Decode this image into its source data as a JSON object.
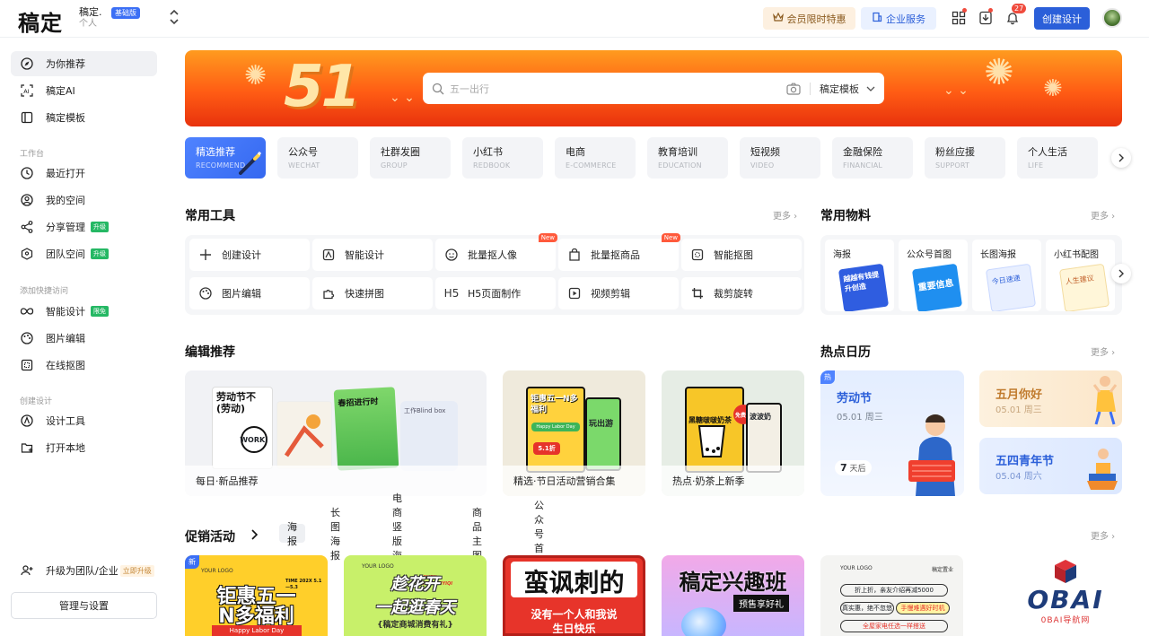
{
  "brand": {
    "logo": "稿定",
    "workspace_name": "稿定.",
    "workspace_type": "个人",
    "plan_badge": "基础版"
  },
  "topbar": {
    "vip_label": "会员限时特惠",
    "enterprise_label": "企业服务",
    "notification_count": "27",
    "create_label": "创建设计"
  },
  "sidebar": {
    "main": [
      {
        "label": "为你推荐"
      },
      {
        "label": "稿定AI"
      },
      {
        "label": "稿定模板"
      }
    ],
    "workbench_label": "工作台",
    "workbench": [
      {
        "label": "最近打开"
      },
      {
        "label": "我的空间"
      },
      {
        "label": "分享管理",
        "tag": "升级"
      },
      {
        "label": "团队空间",
        "tag": "升级"
      }
    ],
    "quick_label": "添加快捷访问",
    "quick": [
      {
        "label": "智能设计",
        "tag": "限免"
      },
      {
        "label": "图片编辑"
      },
      {
        "label": "在线抠图"
      }
    ],
    "create_label": "创建设计",
    "create": [
      {
        "label": "设计工具"
      },
      {
        "label": "打开本地"
      }
    ],
    "upgrade_label": "升级为团队/企业",
    "upgrade_tag": "立即升级",
    "manage_label": "管理与设置"
  },
  "banner": {
    "number": "51",
    "search_placeholder": "五一出行",
    "search_scope": "稿定模板"
  },
  "categories": [
    {
      "cn": "精选推荐",
      "en": "RECOMMEND"
    },
    {
      "cn": "公众号",
      "en": "WECHAT"
    },
    {
      "cn": "社群发圈",
      "en": "GROUP"
    },
    {
      "cn": "小红书",
      "en": "REDBOOK"
    },
    {
      "cn": "电商",
      "en": "E-COMMERCE"
    },
    {
      "cn": "教育培训",
      "en": "EDUCATION"
    },
    {
      "cn": "短视频",
      "en": "VIDEO"
    },
    {
      "cn": "金融保险",
      "en": "FINANCIAL"
    },
    {
      "cn": "粉丝应援",
      "en": "SUPPORT"
    },
    {
      "cn": "个人生活",
      "en": "LIFE"
    }
  ],
  "tools_section": {
    "title": "常用工具",
    "more": "更多",
    "new_badge": "New",
    "items": [
      {
        "label": "创建设计"
      },
      {
        "label": "智能设计"
      },
      {
        "label": "批量抠人像"
      },
      {
        "label": "批量抠商品"
      },
      {
        "label": "智能抠图"
      },
      {
        "label": "图片编辑"
      },
      {
        "label": "快速拼图"
      },
      {
        "label": "H5页面制作",
        "icon_text": "H5"
      },
      {
        "label": "视频剪辑"
      },
      {
        "label": "裁剪旋转"
      }
    ]
  },
  "materials_section": {
    "title": "常用物料",
    "more": "更多",
    "items": [
      {
        "label": "海报",
        "thumb_text": "越越有钱提升创造"
      },
      {
        "label": "公众号首图",
        "thumb_text": "重要信息"
      },
      {
        "label": "长图海报",
        "thumb_text": "今日速递"
      },
      {
        "label": "小红书配图",
        "thumb_text": "人生建议"
      }
    ]
  },
  "editor_section": {
    "title": "编辑推荐",
    "cards": [
      {
        "label": "每日·新品推荐",
        "p1": "劳动节不(劳动)",
        "p2": "WORK!",
        "p3": "春招进行时",
        "p4": "工作Blind box"
      },
      {
        "label": "精选·节日活动营销合集",
        "p1": "钜惠五一N多福利",
        "p2": "Happy Labor Day",
        "p3": "5.1折",
        "p4": "玩出游"
      },
      {
        "label": "热点·奶茶上新季",
        "p1": "黑糖啵啵奶茶",
        "p2": "波波奶",
        "p3": "免费得"
      }
    ]
  },
  "hot_section": {
    "title": "热点日历",
    "more": "更多",
    "tag": "热",
    "main": {
      "name": "劳动节",
      "date": "05.01 周三",
      "countdown_num": "7",
      "countdown_unit": "天后"
    },
    "side": [
      {
        "name": "五月你好",
        "date": "05.01 周三"
      },
      {
        "name": "五四青年节",
        "date": "05.04 周六"
      }
    ]
  },
  "promo_section": {
    "title": "促销活动",
    "more": "更多",
    "tabs": [
      "海报",
      "长图海报",
      "电商竖版海报",
      "商品主图",
      "公众号首图"
    ],
    "cards": [
      {
        "new": "新",
        "logo": "YOUR LOGO",
        "text1": "钜惠五一",
        "text2": "N多福利",
        "text3": "Happy Labor Day",
        "time": "TIME 202X 5.1—5.3"
      },
      {
        "logo": "YOUR LOGO",
        "text1": "趁花开",
        "text2": "一起逛春天",
        "text3": "{稿定商城消费有礼}",
        "side": "CHEN HUAKAIYIQI"
      },
      {
        "text1": "蛮讽刺的",
        "text2": "没有一个人和我说",
        "text3": "生日快乐"
      },
      {
        "text1": "稿定兴趣班",
        "text2": "预售享好礼"
      },
      {
        "logo": "YOUR LOGO",
        "brand": "稿定置业",
        "text1": "折上折，亲友介绍再减5000",
        "text2": "真实惠，绝不忽悠",
        "text3": "手慢难遇好时机",
        "text4": "全屋家电任选一样搭送"
      }
    ]
  },
  "watermark": {
    "text": "OBAI",
    "sub": "0BAI导航网"
  },
  "colors": {
    "primary": "#2b5fd9",
    "accent_red": "#f04b3d",
    "tag_green": "#25b864",
    "banner_orange": "#ff5c14"
  }
}
